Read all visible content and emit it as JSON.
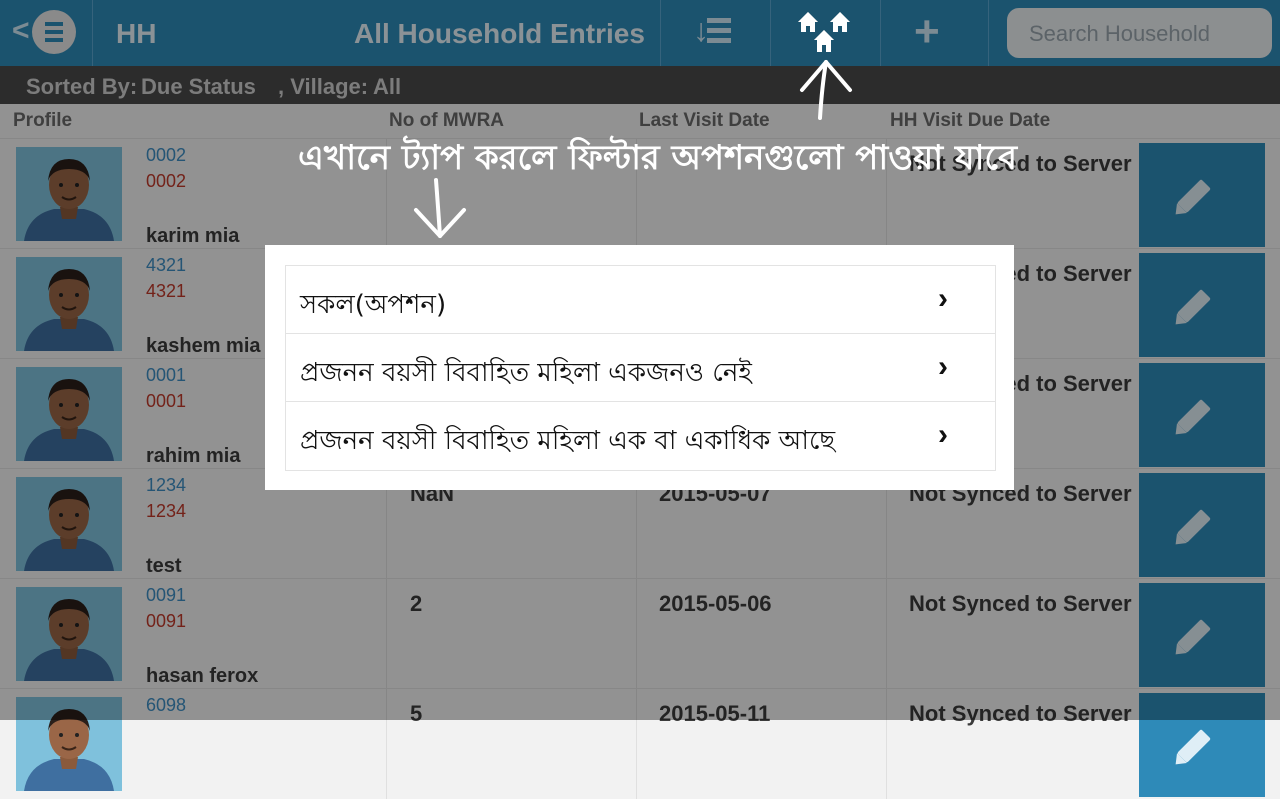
{
  "header": {
    "app_short": "HH",
    "title": "All Household Entries",
    "search_placeholder": "Search Household"
  },
  "sort_bar": {
    "sorted_by_label": "Sorted By:",
    "sorted_by_value": "Due Status",
    "village_label": ", Village:",
    "village_value": "All"
  },
  "table": {
    "columns": {
      "profile": "Profile",
      "mwra": "No of MWRA",
      "last_visit": "Last Visit Date",
      "due_date": "HH Visit Due Date"
    },
    "rows": [
      {
        "id1": "0002",
        "id2": "0002",
        "name": "karim mia",
        "mwra": "",
        "last_visit": "",
        "status": "Not Synced to Server"
      },
      {
        "id1": "4321",
        "id2": "4321",
        "name": "kashem mia",
        "mwra": "",
        "last_visit": "",
        "status": "Not Synced to Server"
      },
      {
        "id1": "0001",
        "id2": "0001",
        "name": "rahim mia",
        "mwra": "",
        "last_visit": "",
        "status": "Not Synced to Server"
      },
      {
        "id1": "1234",
        "id2": "1234",
        "name": "test",
        "mwra": "NaN",
        "last_visit": "2015-05-07",
        "status": "Not Synced to Server"
      },
      {
        "id1": "0091",
        "id2": "0091",
        "name": "hasan ferox",
        "mwra": "2",
        "last_visit": "2015-05-06",
        "status": "Not Synced to Server"
      },
      {
        "id1": "6098",
        "id2": "",
        "name": "",
        "mwra": "5",
        "last_visit": "2015-05-11",
        "status": "Not Synced to Server"
      }
    ]
  },
  "annotation": {
    "text": "এখানে ট্যাপ করলে ফিল্টার অপশনগুলো পাওয়া যাবে"
  },
  "dialog": {
    "options": [
      {
        "label": "সকল(অপশন)"
      },
      {
        "label": "প্রজনন বয়সী বিবাহিত মহিলা একজনও নেই"
      },
      {
        "label": "প্রজনন বয়সী বিবাহিত মহিলা এক বা একাধিক আছে"
      }
    ]
  },
  "colors": {
    "topbar": "#2e8ab8",
    "sortbar": "#4a4a4a",
    "id_blue": "#3e8ec4",
    "id_red": "#c0392b"
  }
}
